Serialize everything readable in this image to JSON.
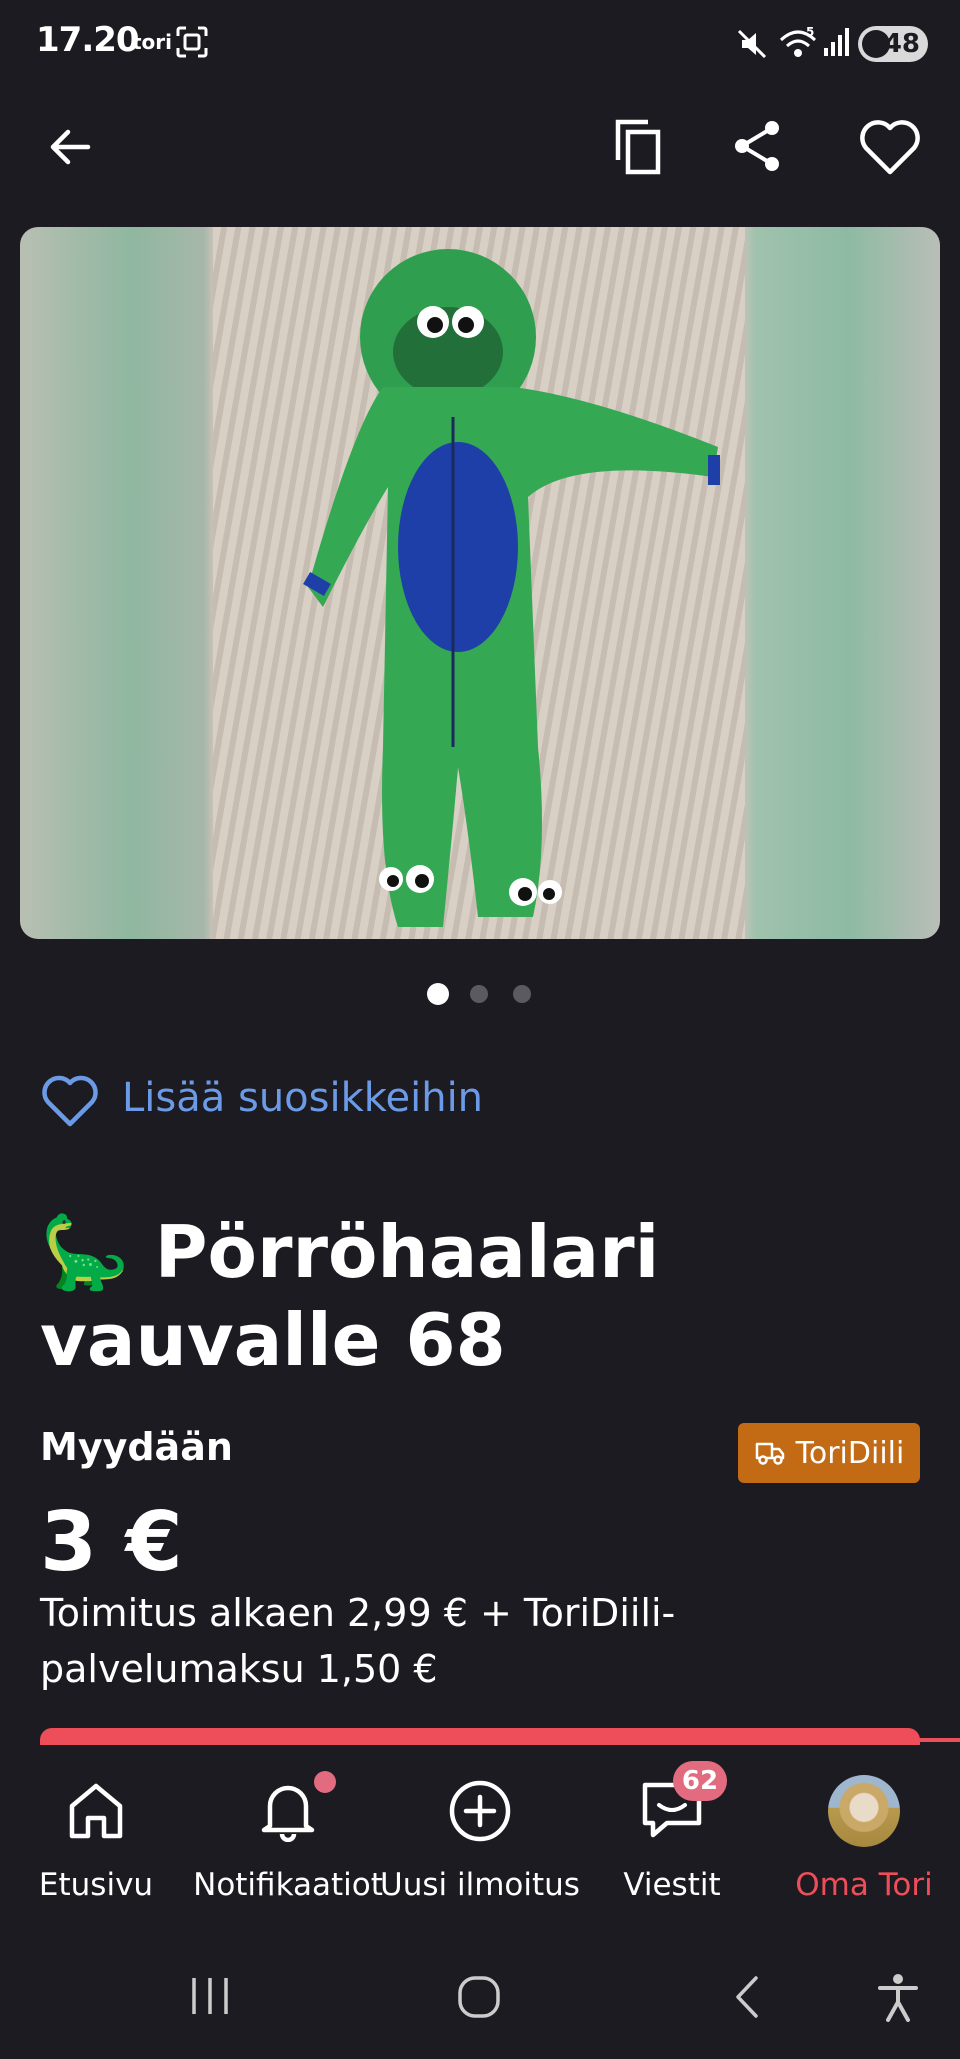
{
  "status_bar": {
    "time": "17.20",
    "app": "tori",
    "battery": "48",
    "signal_label": "5"
  },
  "listing": {
    "add_favorite_label": "Lisää suosikkeihin",
    "title": "🦕 Pörröhaalari vauvalle 68",
    "type_label": "Myydään",
    "deal_badge": "ToriDiili",
    "price": "3 €",
    "shipping": "Toimitus alkaen 2,99 € + ToriDiili-palvelumaksu 1,50 €",
    "image_count": 3,
    "active_image_index": 1
  },
  "bottom_nav": {
    "items": [
      {
        "label": "Etusivu",
        "icon": "home-icon"
      },
      {
        "label": "Notifikaatiot",
        "icon": "bell-icon"
      },
      {
        "label": "Uusi ilmoitus",
        "icon": "plus-circle-icon"
      },
      {
        "label": "Viestit",
        "icon": "chat-icon",
        "badge": "62"
      },
      {
        "label": "Oma Tori",
        "icon": "avatar"
      }
    ]
  },
  "colors": {
    "accent": "#ee4e5a",
    "link": "#6b9be6",
    "deal": "#c26a14",
    "background": "#1c1b21"
  }
}
